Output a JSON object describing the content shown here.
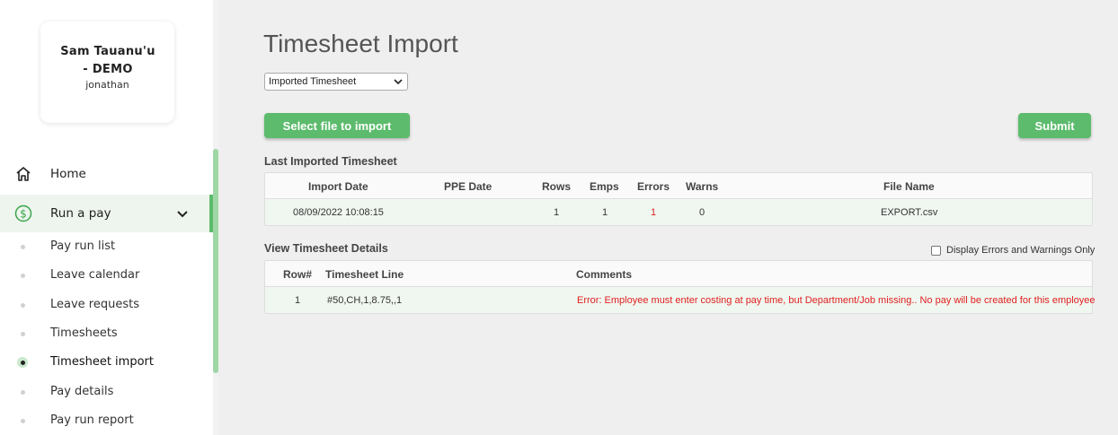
{
  "sidebar": {
    "user": {
      "name": "Sam Tauanu'u - DEMO",
      "username": "jonathan"
    },
    "nav": [
      {
        "label": "Home",
        "icon": "home-icon"
      },
      {
        "label": "Run a pay",
        "icon": "dollar-icon"
      }
    ],
    "sub_items": [
      {
        "label": "Pay run list"
      },
      {
        "label": "Leave calendar"
      },
      {
        "label": "Leave requests"
      },
      {
        "label": "Timesheets"
      },
      {
        "label": "Timesheet import"
      },
      {
        "label": "Pay details"
      },
      {
        "label": "Pay run report"
      }
    ],
    "active_sub_item": "Timesheet import"
  },
  "main": {
    "title": "Timesheet Import",
    "import_type": {
      "selected": "Imported Timesheet"
    },
    "select_file_label": "Select file to import",
    "submit_label": "Submit",
    "last_imported": {
      "label": "Last Imported Timesheet",
      "columns": [
        "Import Date",
        "PPE Date",
        "Rows",
        "Emps",
        "Errors",
        "Warns",
        "File Name"
      ],
      "rows": [
        {
          "import_date": "08/09/2022 10:08:15",
          "ppe_date": "",
          "rows": "1",
          "emps": "1",
          "errors": "1",
          "warns": "0",
          "file_name": "EXPORT.csv"
        }
      ]
    },
    "details": {
      "label": "View Timesheet Details",
      "filter_label": "Display Errors and Warnings Only",
      "columns": [
        "Row#",
        "Timesheet Line",
        "Comments"
      ],
      "rows": [
        {
          "row": "1",
          "line": "#50,CH,1,8.75,,1",
          "comment": "Error: Employee must enter costing at pay time, but Department/Job missing.. No pay will be created for this employee"
        }
      ]
    }
  },
  "colors": {
    "accent": "#5cbb6c",
    "error": "#e02020"
  }
}
